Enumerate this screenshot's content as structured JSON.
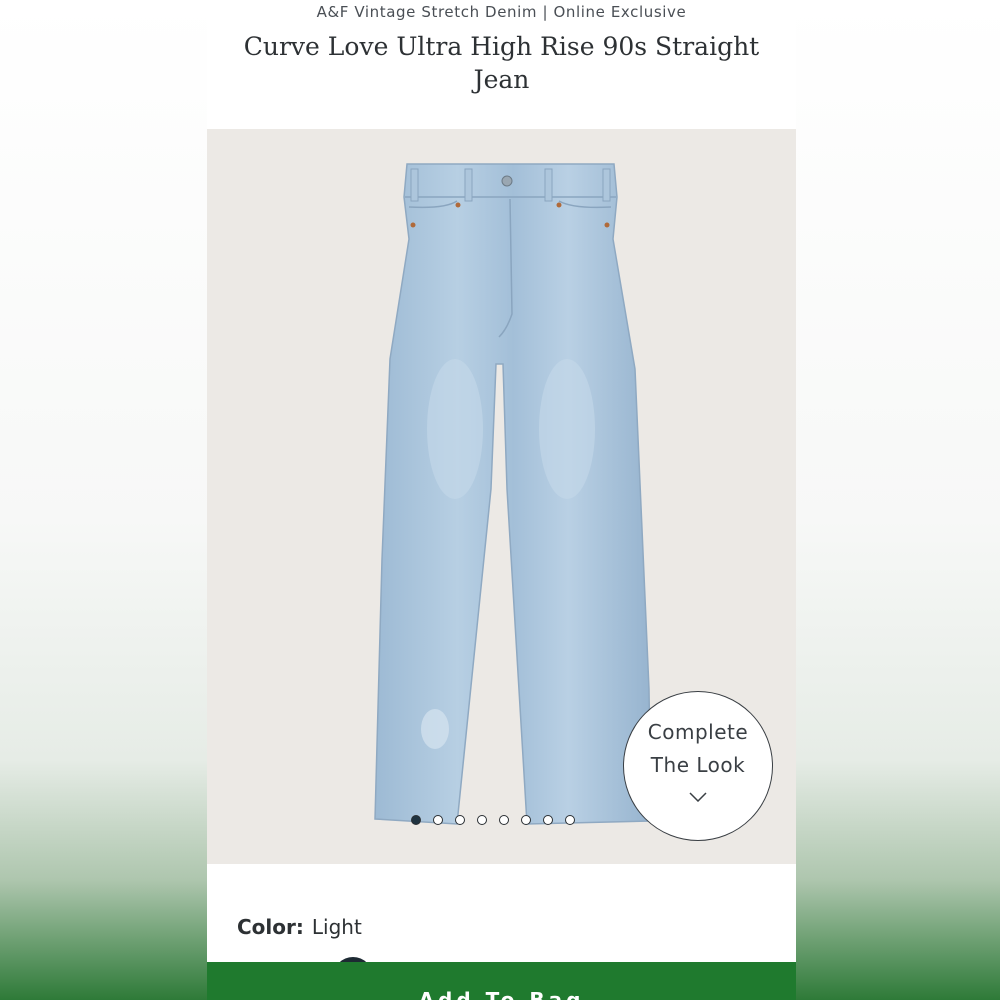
{
  "header": {
    "subtitle": "A&F Vintage Stretch Denim | Online Exclusive",
    "title": "Curve Love Ultra High Rise 90s Straight Jean"
  },
  "gallery": {
    "image_alt": "Light wash ultra high rise 90s straight jeans",
    "image_count": 8,
    "active_index": 0,
    "complete_the_look": {
      "line1": "Complete",
      "line2": "The Look",
      "icon": "chevron-down-icon"
    }
  },
  "product": {
    "color_label": "Color:",
    "color_value": "Light",
    "add_to_bag_label": "Add To Bag"
  },
  "colors": {
    "add_button_bg": "#1f7a2e",
    "image_bg": "#ece9e5",
    "denim": "#a9c4dc"
  }
}
